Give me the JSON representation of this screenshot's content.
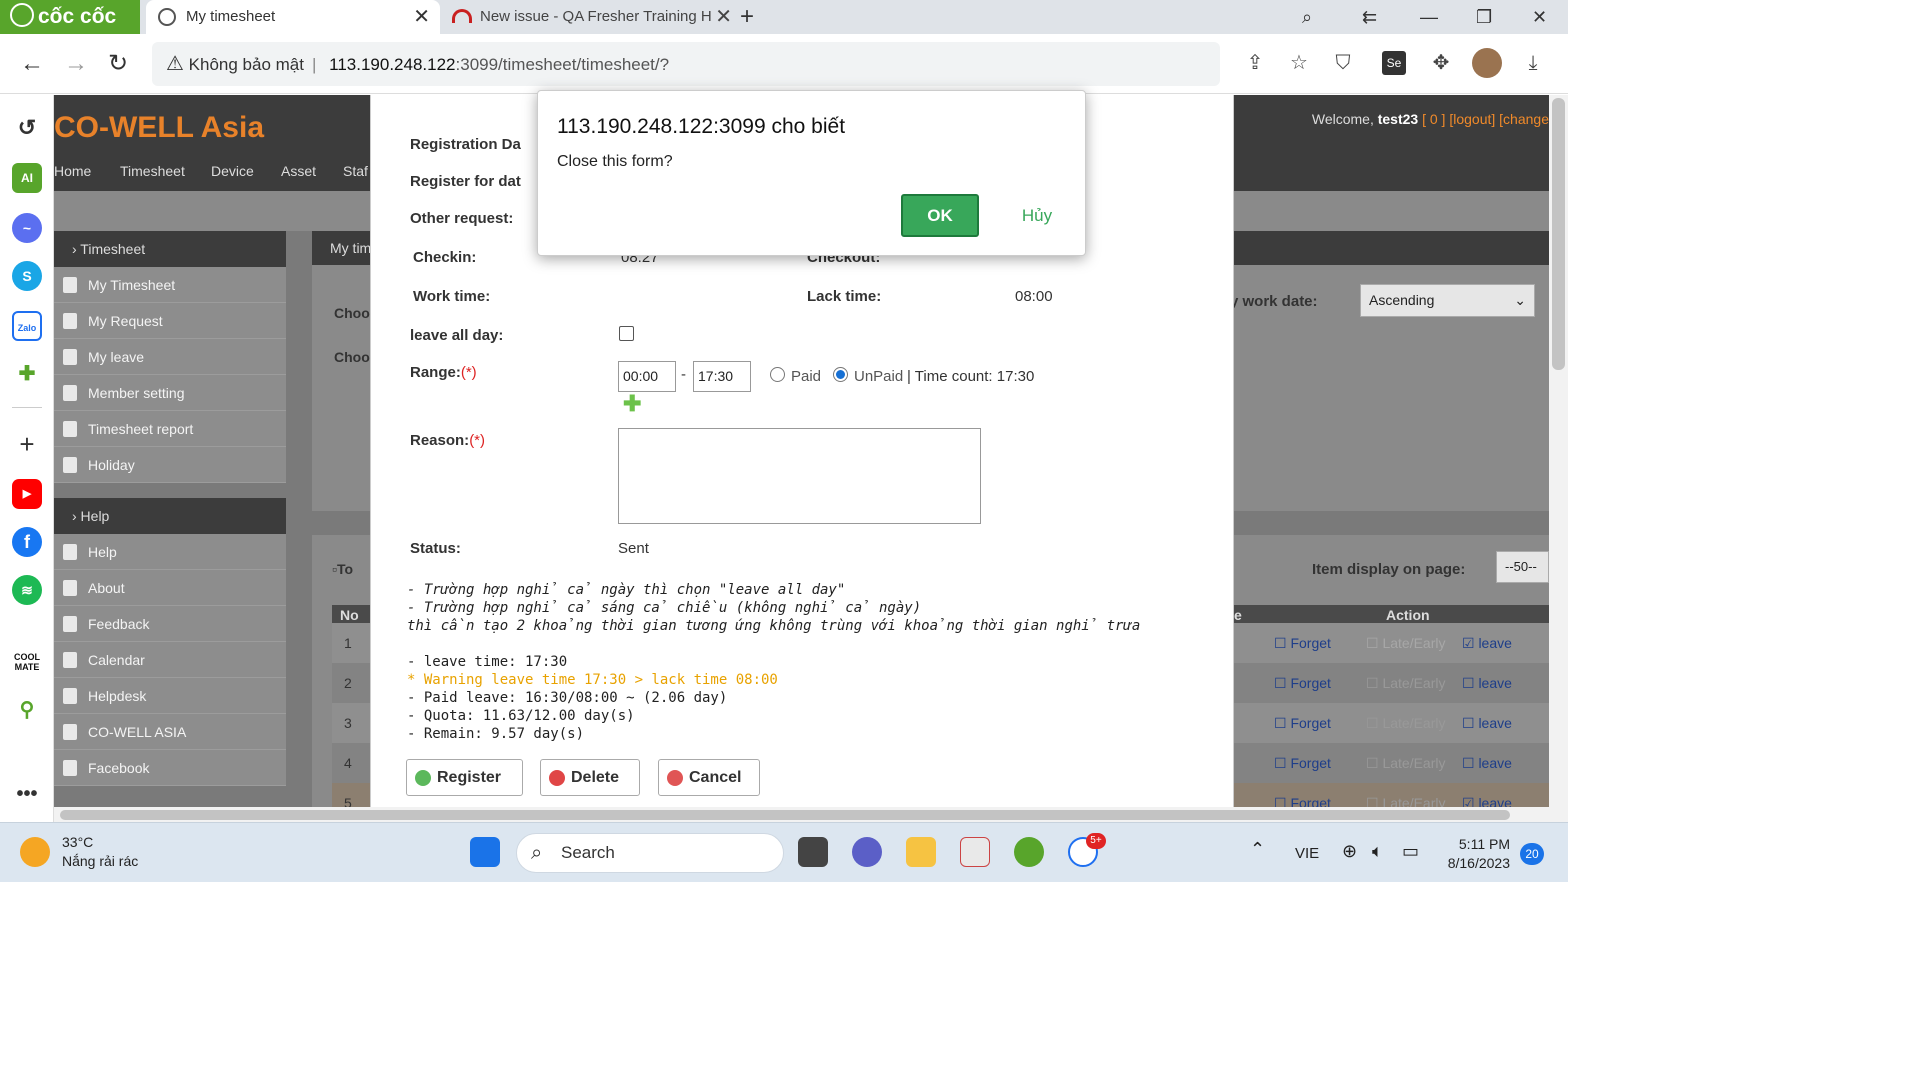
{
  "browser": {
    "logo": "cốc cốc",
    "tabs": [
      {
        "label": "My timesheet"
      },
      {
        "label": "New issue - QA Fresher Training H"
      }
    ],
    "security": "Không bảo mật",
    "url_host": "113.190.248.122",
    "url_path": ":3099/timesheet/timesheet/?"
  },
  "site": {
    "brand": "CO-WELL Asia",
    "nav": [
      "Home",
      "Timesheet",
      "Device",
      "Asset",
      "Staf"
    ],
    "welcome_prefix": "Welcome,",
    "user": "test23",
    "counter": "[ 0 ]",
    "logout": "[logout]",
    "change": "[change"
  },
  "sidebar": {
    "timesheet_head": "› Timesheet",
    "timesheet_items": [
      "My Timesheet",
      "My Request",
      "My leave",
      "Member setting",
      "Timesheet report",
      "Holiday"
    ],
    "help_head": "› Help",
    "help_items": [
      "Help",
      "About",
      "Feedback",
      "Calendar",
      "Helpdesk",
      "CO-WELL ASIA",
      "Facebook"
    ]
  },
  "background_panel": {
    "header": "My tim",
    "choose1": "Choo",
    "choose2": "Choo",
    "sort_label": "y work date:",
    "sort_value": "Ascending",
    "to_label": "To",
    "item_display_label": "Item display on page:",
    "item_display_value": "--50--",
    "col_no": "No",
    "col_e": "e",
    "col_action": "Action",
    "rows": [
      {
        "no": "1",
        "forget": "☐ Forget",
        "late": "☐ Late/Early",
        "leave": "☑ leave"
      },
      {
        "no": "2",
        "forget": "☐ Forget",
        "late": "☐ Late/Early",
        "leave": "☐ leave"
      },
      {
        "no": "3",
        "forget": "☐ Forget",
        "late": "☐ Late/Early",
        "leave": "☐ leave"
      },
      {
        "no": "4",
        "forget": "☐ Forget",
        "late": "☐ Late/Early",
        "leave": "☐ leave"
      },
      {
        "no": "5",
        "forget": "☐ Forget",
        "late": "☐ Late/Early",
        "leave": "☑ leave"
      }
    ]
  },
  "form": {
    "registration_date_label": "Registration Da",
    "register_for_date_label": "Register for dat",
    "other_request_label": "Other request:",
    "checkin_label": "Checkin:",
    "checkin_value": "08:27",
    "checkout_label": "Checkout:",
    "work_time_label": "Work time:",
    "lack_time_label": "Lack time:",
    "lack_time_value": "08:00",
    "leave_all_day_label": "leave all day:",
    "range_label": "Range:",
    "required_mark": "(*)",
    "range_from": "00:00",
    "range_dash": "-",
    "range_to": "17:30",
    "paid_label": "Paid",
    "unpaid_label": "UnPaid",
    "time_count": "| Time count: 17:30",
    "reason_label": "Reason:",
    "status_label": "Status:",
    "status_value": "Sent",
    "notes": [
      "- Trường hợp nghỉ cả ngày thì chọn \"leave all day\"",
      "- Trường hợp nghỉ cả sáng cả chiều (không nghỉ cả ngày)",
      "thì cần tạo 2 khoảng thời gian tương ứng không trùng với khoảng thời gian nghỉ trưa",
      "",
      "- leave time: 17:30"
    ],
    "warning": "* Warning leave time 17:30 > lack time 08:00",
    "notes2": [
      "- Paid leave: 16:30/08:00 ~ (2.06 day)",
      "- Quota: 11.63/12.00 day(s)",
      "- Remain: 9.57 day(s)"
    ],
    "register_btn": "Register",
    "delete_btn": "Delete",
    "cancel_btn": "Cancel"
  },
  "alert": {
    "title": "113.190.248.122:3099 cho biết",
    "message": "Close this form?",
    "ok": "OK",
    "cancel": "Hủy"
  },
  "taskbar": {
    "temp": "33°C",
    "weather": "Nắng rải rác",
    "search": "Search",
    "lang": "VIE",
    "time": "5:11 PM",
    "date": "8/16/2023",
    "notif_count": "20",
    "zalo_badge": "5+"
  },
  "colors": {
    "brand": "#e8822a",
    "ok_button": "#38a75a",
    "warning_text": "#e8a200",
    "required": "#dd2222"
  }
}
